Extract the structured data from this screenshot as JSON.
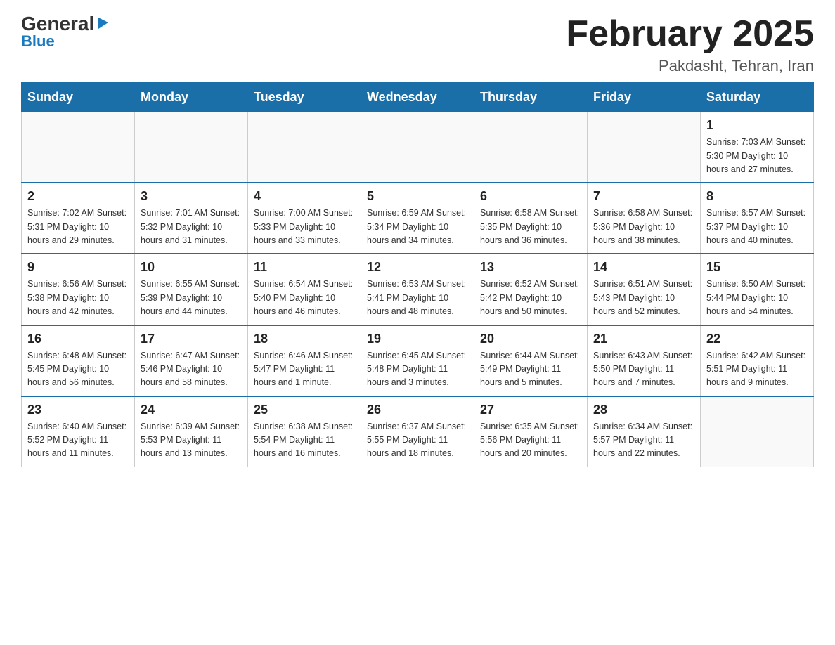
{
  "logo": {
    "general": "General",
    "blue": "Blue",
    "arrow": "▶"
  },
  "title": "February 2025",
  "location": "Pakdasht, Tehran, Iran",
  "weekdays": [
    "Sunday",
    "Monday",
    "Tuesday",
    "Wednesday",
    "Thursday",
    "Friday",
    "Saturday"
  ],
  "weeks": [
    [
      {
        "day": "",
        "info": ""
      },
      {
        "day": "",
        "info": ""
      },
      {
        "day": "",
        "info": ""
      },
      {
        "day": "",
        "info": ""
      },
      {
        "day": "",
        "info": ""
      },
      {
        "day": "",
        "info": ""
      },
      {
        "day": "1",
        "info": "Sunrise: 7:03 AM\nSunset: 5:30 PM\nDaylight: 10 hours and 27 minutes."
      }
    ],
    [
      {
        "day": "2",
        "info": "Sunrise: 7:02 AM\nSunset: 5:31 PM\nDaylight: 10 hours and 29 minutes."
      },
      {
        "day": "3",
        "info": "Sunrise: 7:01 AM\nSunset: 5:32 PM\nDaylight: 10 hours and 31 minutes."
      },
      {
        "day": "4",
        "info": "Sunrise: 7:00 AM\nSunset: 5:33 PM\nDaylight: 10 hours and 33 minutes."
      },
      {
        "day": "5",
        "info": "Sunrise: 6:59 AM\nSunset: 5:34 PM\nDaylight: 10 hours and 34 minutes."
      },
      {
        "day": "6",
        "info": "Sunrise: 6:58 AM\nSunset: 5:35 PM\nDaylight: 10 hours and 36 minutes."
      },
      {
        "day": "7",
        "info": "Sunrise: 6:58 AM\nSunset: 5:36 PM\nDaylight: 10 hours and 38 minutes."
      },
      {
        "day": "8",
        "info": "Sunrise: 6:57 AM\nSunset: 5:37 PM\nDaylight: 10 hours and 40 minutes."
      }
    ],
    [
      {
        "day": "9",
        "info": "Sunrise: 6:56 AM\nSunset: 5:38 PM\nDaylight: 10 hours and 42 minutes."
      },
      {
        "day": "10",
        "info": "Sunrise: 6:55 AM\nSunset: 5:39 PM\nDaylight: 10 hours and 44 minutes."
      },
      {
        "day": "11",
        "info": "Sunrise: 6:54 AM\nSunset: 5:40 PM\nDaylight: 10 hours and 46 minutes."
      },
      {
        "day": "12",
        "info": "Sunrise: 6:53 AM\nSunset: 5:41 PM\nDaylight: 10 hours and 48 minutes."
      },
      {
        "day": "13",
        "info": "Sunrise: 6:52 AM\nSunset: 5:42 PM\nDaylight: 10 hours and 50 minutes."
      },
      {
        "day": "14",
        "info": "Sunrise: 6:51 AM\nSunset: 5:43 PM\nDaylight: 10 hours and 52 minutes."
      },
      {
        "day": "15",
        "info": "Sunrise: 6:50 AM\nSunset: 5:44 PM\nDaylight: 10 hours and 54 minutes."
      }
    ],
    [
      {
        "day": "16",
        "info": "Sunrise: 6:48 AM\nSunset: 5:45 PM\nDaylight: 10 hours and 56 minutes."
      },
      {
        "day": "17",
        "info": "Sunrise: 6:47 AM\nSunset: 5:46 PM\nDaylight: 10 hours and 58 minutes."
      },
      {
        "day": "18",
        "info": "Sunrise: 6:46 AM\nSunset: 5:47 PM\nDaylight: 11 hours and 1 minute."
      },
      {
        "day": "19",
        "info": "Sunrise: 6:45 AM\nSunset: 5:48 PM\nDaylight: 11 hours and 3 minutes."
      },
      {
        "day": "20",
        "info": "Sunrise: 6:44 AM\nSunset: 5:49 PM\nDaylight: 11 hours and 5 minutes."
      },
      {
        "day": "21",
        "info": "Sunrise: 6:43 AM\nSunset: 5:50 PM\nDaylight: 11 hours and 7 minutes."
      },
      {
        "day": "22",
        "info": "Sunrise: 6:42 AM\nSunset: 5:51 PM\nDaylight: 11 hours and 9 minutes."
      }
    ],
    [
      {
        "day": "23",
        "info": "Sunrise: 6:40 AM\nSunset: 5:52 PM\nDaylight: 11 hours and 11 minutes."
      },
      {
        "day": "24",
        "info": "Sunrise: 6:39 AM\nSunset: 5:53 PM\nDaylight: 11 hours and 13 minutes."
      },
      {
        "day": "25",
        "info": "Sunrise: 6:38 AM\nSunset: 5:54 PM\nDaylight: 11 hours and 16 minutes."
      },
      {
        "day": "26",
        "info": "Sunrise: 6:37 AM\nSunset: 5:55 PM\nDaylight: 11 hours and 18 minutes."
      },
      {
        "day": "27",
        "info": "Sunrise: 6:35 AM\nSunset: 5:56 PM\nDaylight: 11 hours and 20 minutes."
      },
      {
        "day": "28",
        "info": "Sunrise: 6:34 AM\nSunset: 5:57 PM\nDaylight: 11 hours and 22 minutes."
      },
      {
        "day": "",
        "info": ""
      }
    ]
  ]
}
